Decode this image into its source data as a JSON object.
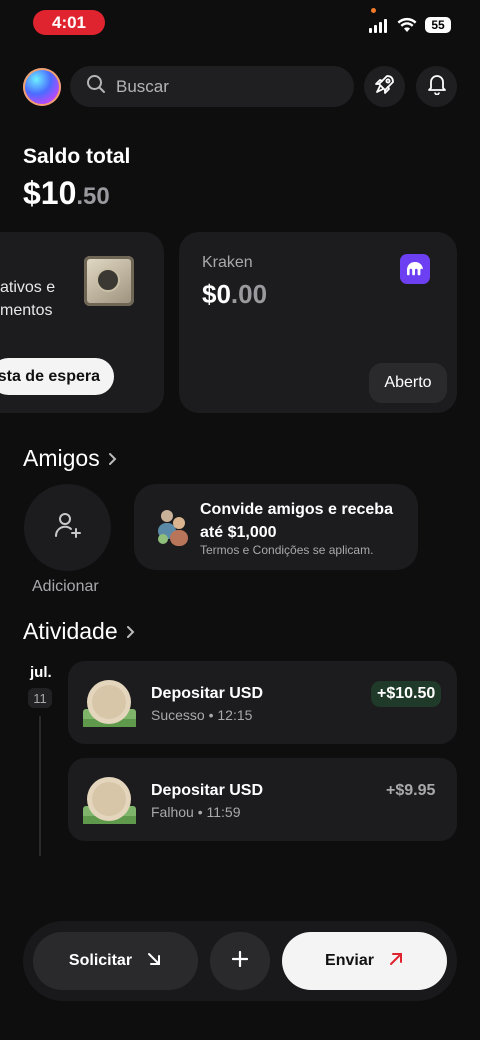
{
  "status_bar": {
    "time": "4:01",
    "battery": "55"
  },
  "header": {
    "search_placeholder": "Buscar"
  },
  "balance": {
    "label": "Saldo total",
    "whole": "$10",
    "decimal": ".50"
  },
  "cards": {
    "vault": {
      "text_line1": "ativos e",
      "text_line2": "mentos",
      "button": "sta de espera"
    },
    "kraken": {
      "label": "Kraken",
      "whole": "$0",
      "decimal": ".00",
      "button": "Aberto"
    }
  },
  "friends": {
    "title": "Amigos",
    "add_label": "Adicionar",
    "invite_title": "Convide amigos e receba até $1,000",
    "invite_sub": "Termos e Condições se aplicam."
  },
  "activity": {
    "title": "Atividade",
    "month": "jul.",
    "day": "11",
    "items": [
      {
        "title": "Depositar USD",
        "status": "Sucesso • 12:15",
        "amount": "+$10.50"
      },
      {
        "title": "Depositar USD",
        "status": "Falhou • 11:59",
        "amount": "+$9.95"
      }
    ]
  },
  "bottom_bar": {
    "request": "Solicitar",
    "send": "Enviar"
  },
  "colors": {
    "accent_red": "#e0242f",
    "kraken_purple": "#6d3ff2",
    "success_badge": "#1f3a28"
  }
}
